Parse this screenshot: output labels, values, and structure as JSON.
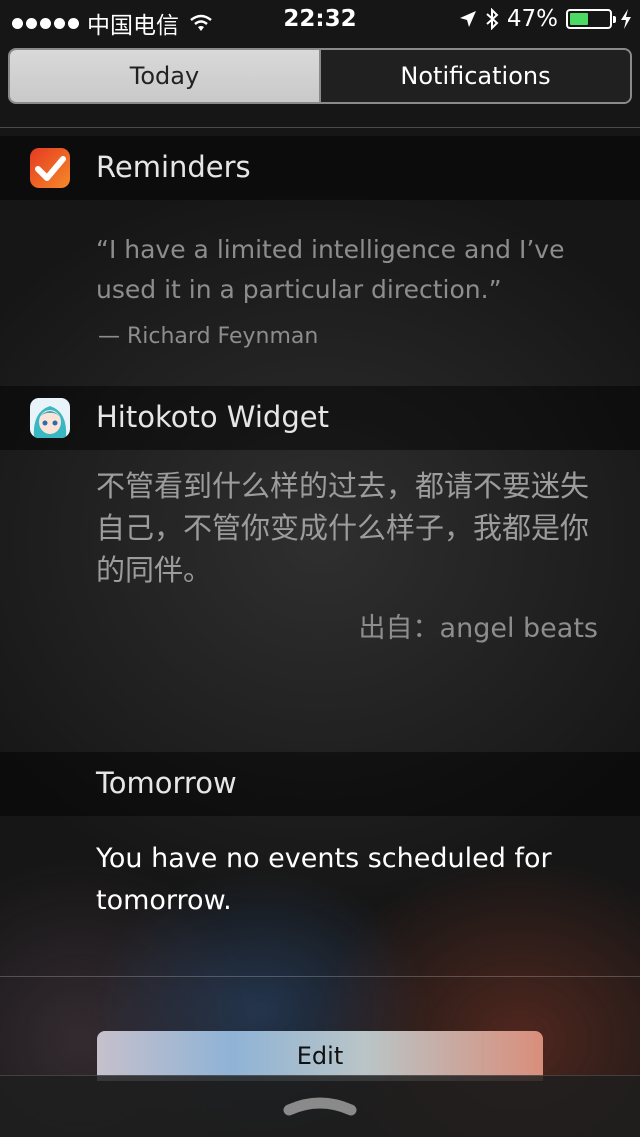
{
  "status_bar": {
    "carrier": "中国电信",
    "time": "22:32",
    "battery_percent": "47%",
    "battery_level": 0.47,
    "icons": [
      "signal-dots-icon",
      "wifi-icon",
      "location-arrow-icon",
      "bluetooth-icon",
      "battery-icon",
      "charging-bolt-icon"
    ]
  },
  "tabs": [
    {
      "label": "Today",
      "active": true
    },
    {
      "label": "Notifications",
      "active": false
    }
  ],
  "widgets": {
    "reminders": {
      "title": "Reminders",
      "icon": "reminders-checkmark-icon",
      "quote": "“I have a limited intelligence and I’ve used it in a particular direction.”",
      "author": "— Richard Feynman"
    },
    "hitokoto": {
      "title": "Hitokoto Widget",
      "icon": "anime-avatar-icon",
      "text": "不管看到什么样的过去，都请不要迷失自己，不管你变成什么样子，我都是你的同伴。",
      "source": "出自：angel beats"
    },
    "tomorrow": {
      "title": "Tomorrow",
      "text": "You have no events scheduled for tomorrow."
    }
  },
  "edit_button": {
    "label": "Edit"
  },
  "colors": {
    "battery_green": "#4cd964",
    "reminders_red": "#e53a22",
    "reminders_orange": "#f58a2a"
  }
}
